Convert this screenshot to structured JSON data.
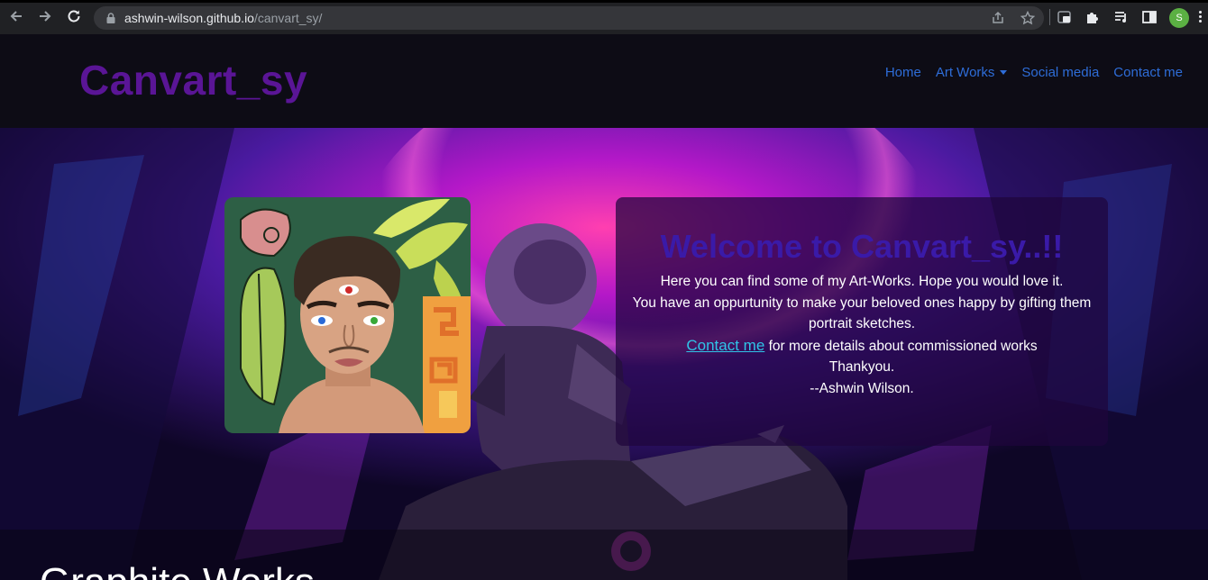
{
  "browser": {
    "url_host": "ashwin-wilson.github.io",
    "url_path": "/canvart_sy/",
    "profile_initial": "S"
  },
  "navbar": {
    "brand": "Canvart_sy",
    "links": [
      {
        "label": "Home"
      },
      {
        "label": "Art Works"
      },
      {
        "label": "Social media"
      },
      {
        "label": "Contact me"
      }
    ]
  },
  "welcome": {
    "title": "Welcome to Canvart_sy..!!",
    "line1": "Here you can find some of my Art-Works. Hope you would love it.",
    "line2": "You have an oppurtunity to make your beloved ones happy by gifting them portrait sketches.",
    "contact_link": "Contact me",
    "contact_rest": " for more details about commissioned works",
    "thanks": "Thankyou.",
    "signature": "--Ashwin Wilson."
  },
  "section": {
    "title": "Graphite Works"
  },
  "colors": {
    "brand": "#5a1596",
    "nav_link": "#2e6dd8",
    "welcome_title": "#3a1aa8",
    "contact_link": "#30c4e8"
  }
}
